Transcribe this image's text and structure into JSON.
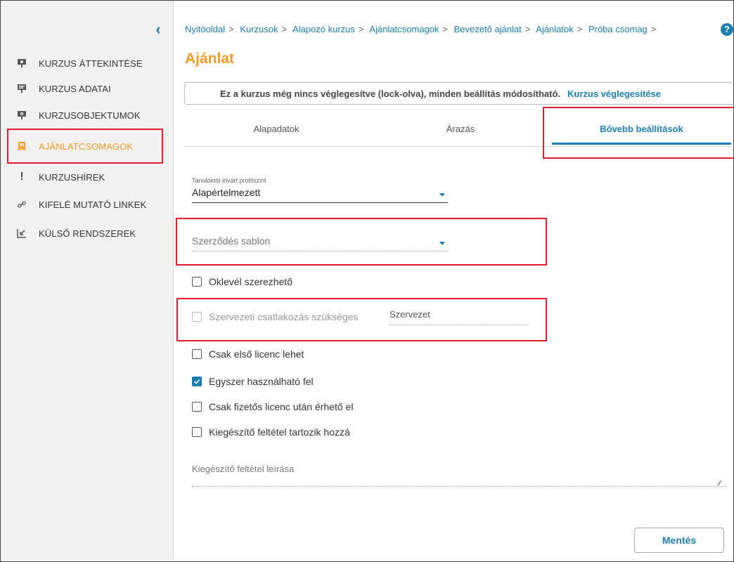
{
  "sidebar": {
    "items": [
      {
        "label": "KURZUS ÁTTEKINTÉSE",
        "icon": "presentation-icon"
      },
      {
        "label": "KURZUS ADATAI",
        "icon": "presentation-board-icon"
      },
      {
        "label": "KURZUSOBJEKTUMOK",
        "icon": "presentation-settings-icon"
      },
      {
        "label": "AJÁNLATCSOMAGOK",
        "icon": "offer-package-icon",
        "active": true
      },
      {
        "label": "KURZUSHÍREK",
        "icon": "exclamation-icon"
      },
      {
        "label": "KIFELÉ MUTATÓ LINKEK",
        "icon": "link-icon"
      },
      {
        "label": "KÜLSŐ RENDSZEREK",
        "icon": "external-arrow-icon"
      }
    ]
  },
  "breadcrumb": [
    "Nyitóoldal",
    "Kurzusok",
    "Alapozó kurzus",
    "Ajánlatcsomagok",
    "Bevezető ajánlat",
    "Ajánlatok",
    "Próba csomag"
  ],
  "breadcrumb_separator": ">",
  "help_label": "?",
  "page_title": "Ajánlat",
  "notice": {
    "text": "Ez a kurzus még nincs véglegesítve (lock-olva), minden beállítás módosítható.",
    "link": "Kurzus véglegesítése"
  },
  "tabs": [
    "Alapadatok",
    "Árazás",
    "Bővebb beállítások"
  ],
  "active_tab": "Bővebb beállítások",
  "form": {
    "profile_label": "Tanulóktól elvárt profilszint",
    "profile_value": "Alapértelmezett",
    "contract_placeholder": "Szerződés sablon",
    "diploma": "Oklevél szerezhető",
    "org_join": "Szervezeti csatlakozás szükséges",
    "org_placeholder": "Szervezet",
    "first_license": "Csak első licenc lehet",
    "single_use": "Egyszer használható fel",
    "paid_only": "Csak fizetős licenc után érhető el",
    "extra_condition": "Kiegészítő feltétel tartozik hozzá",
    "extra_desc_label": "Kiegészítő feltétel leírása"
  },
  "save_label": "Mentés",
  "colors": {
    "accent": "#1d7fb0",
    "active": "#f39c2a",
    "annotation": "#e0202f"
  }
}
